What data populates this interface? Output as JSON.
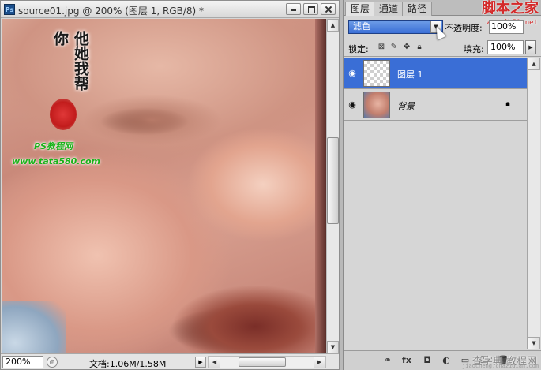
{
  "document_window": {
    "title": "source01.jpg @ 200% (图层 1, RGB/8) *",
    "ps_badge": "Ps",
    "watermark": {
      "calligraphy": "他她我帮你",
      "site_name": "PS教程网",
      "url": "www.tata580.com"
    },
    "status": {
      "zoom": "200%",
      "doc_size": "文档:1.06M/1.58M"
    }
  },
  "layers_panel": {
    "tabs": [
      {
        "label": "图层",
        "active": true
      },
      {
        "label": "通道",
        "active": false
      },
      {
        "label": "路径",
        "active": false
      }
    ],
    "brand_stamp": "脚本之家",
    "brand_url": "www.jb51.net",
    "blend_mode": "滤色",
    "opacity_label": "不透明度:",
    "opacity_value": "100%",
    "lock_label": "锁定:",
    "fill_label": "填充:",
    "fill_value": "100%",
    "layers": [
      {
        "name": "图层 1",
        "selected": true,
        "thumb": "transparent",
        "locked": false
      },
      {
        "name": "背景",
        "selected": false,
        "thumb": "photo",
        "locked": true
      }
    ],
    "footer": {
      "icons": [
        "link-icon",
        "fx-icon",
        "mask-icon",
        "adjustment-icon",
        "folder-icon",
        "new-layer-icon",
        "trash-icon"
      ],
      "stamp": "查字典 教程网",
      "url": "jiaocheng.chazidian.com"
    }
  },
  "colors": {
    "selection_blue": "#3a6ed6",
    "watermark_green": "#18b318",
    "brand_red": "#d42a2a"
  }
}
